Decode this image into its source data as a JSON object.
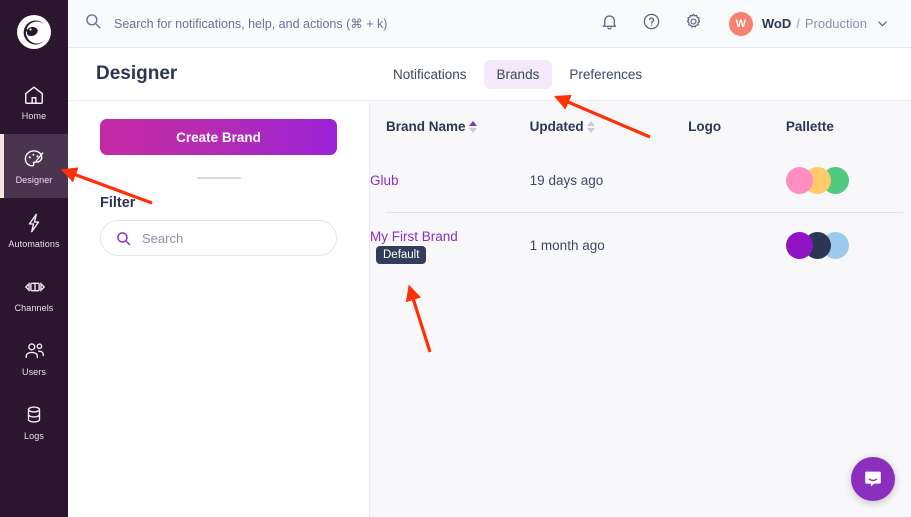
{
  "sidebar": {
    "logo_icon": "courier-bird-logo",
    "items": [
      {
        "label": "Home",
        "icon": "home-icon",
        "active": false
      },
      {
        "label": "Designer",
        "icon": "palette-icon",
        "active": true
      },
      {
        "label": "Automations",
        "icon": "lightning-icon",
        "active": false
      },
      {
        "label": "Channels",
        "icon": "channels-icon",
        "active": false
      },
      {
        "label": "Users",
        "icon": "users-icon",
        "active": false
      },
      {
        "label": "Logs",
        "icon": "database-icon",
        "active": false
      }
    ]
  },
  "topbar": {
    "search_placeholder": "Search for notifications, help, and actions (⌘ + k)",
    "search_icon": "search-icon",
    "bell_icon": "bell-icon",
    "help_icon": "help-circle-icon",
    "settings_icon": "gear-icon",
    "avatar_initial": "W",
    "avatar_color": "#F98172",
    "org_name": "WoD",
    "org_separator": "/",
    "org_environment": "Production",
    "chevron_icon": "chevron-down-icon"
  },
  "page": {
    "title": "Designer",
    "tabs": [
      {
        "label": "Notifications",
        "active": false
      },
      {
        "label": "Brands",
        "active": true
      },
      {
        "label": "Preferences",
        "active": false
      }
    ]
  },
  "left_panel": {
    "create_button": "Create Brand",
    "filter_label": "Filter",
    "search_placeholder": "Search",
    "search_value": "",
    "search_icon": "search-icon"
  },
  "table": {
    "columns": [
      {
        "label": "Brand Name",
        "sortable": true,
        "sort": "asc"
      },
      {
        "label": "Updated",
        "sortable": true,
        "sort": "none"
      },
      {
        "label": "Logo",
        "sortable": false,
        "sort": null
      },
      {
        "label": "Pallette",
        "sortable": false,
        "sort": null
      }
    ],
    "rows": [
      {
        "name": "Glub",
        "badge": "",
        "updated": "19 days ago",
        "logo": "",
        "palette": [
          "#FF8EC0",
          "#FFCB6B",
          "#4FC97E"
        ],
        "action_icon": "chevron-down-icon"
      },
      {
        "name": "My First Brand",
        "badge": "Default",
        "updated": "1 month ago",
        "logo": "",
        "palette": [
          "#9114C4",
          "#2C3654",
          "#93C5EB"
        ],
        "action_icon": "chevron-down-icon"
      }
    ]
  },
  "widgets": {
    "intercom_icon": "intercom-message-icon",
    "intercom_color": "#8B2FBE"
  },
  "annotations": {
    "arrow_color": "#FF3008",
    "arrows": [
      {
        "name": "arrow-to-designer-nav"
      },
      {
        "name": "arrow-to-brands-tab"
      },
      {
        "name": "arrow-to-my-first-brand"
      }
    ]
  },
  "theme": {
    "sidebar_bg": "#2B152F",
    "accent_purple": "#8B2FBE",
    "tab_active_bg": "#F3E9F8",
    "text_dark": "#2C3654"
  }
}
